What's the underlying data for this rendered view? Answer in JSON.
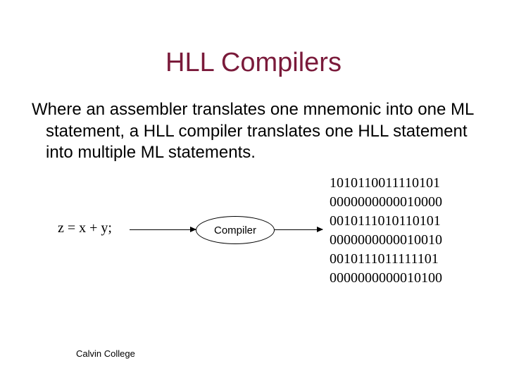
{
  "title": "HLL Compilers",
  "paragraph": "Where an assembler translates one mnemonic into one ML statement,\na HLL compiler translates one HLL statement into multiple ML statements.",
  "source_code": "z = x + y;",
  "compiler_label": "Compiler",
  "ml_lines": [
    "1010110011110101",
    "0000000000010000",
    "0010111010110101",
    "0000000000010010",
    "0010111011111101",
    "0000000000010100"
  ],
  "footer": "Calvin College"
}
